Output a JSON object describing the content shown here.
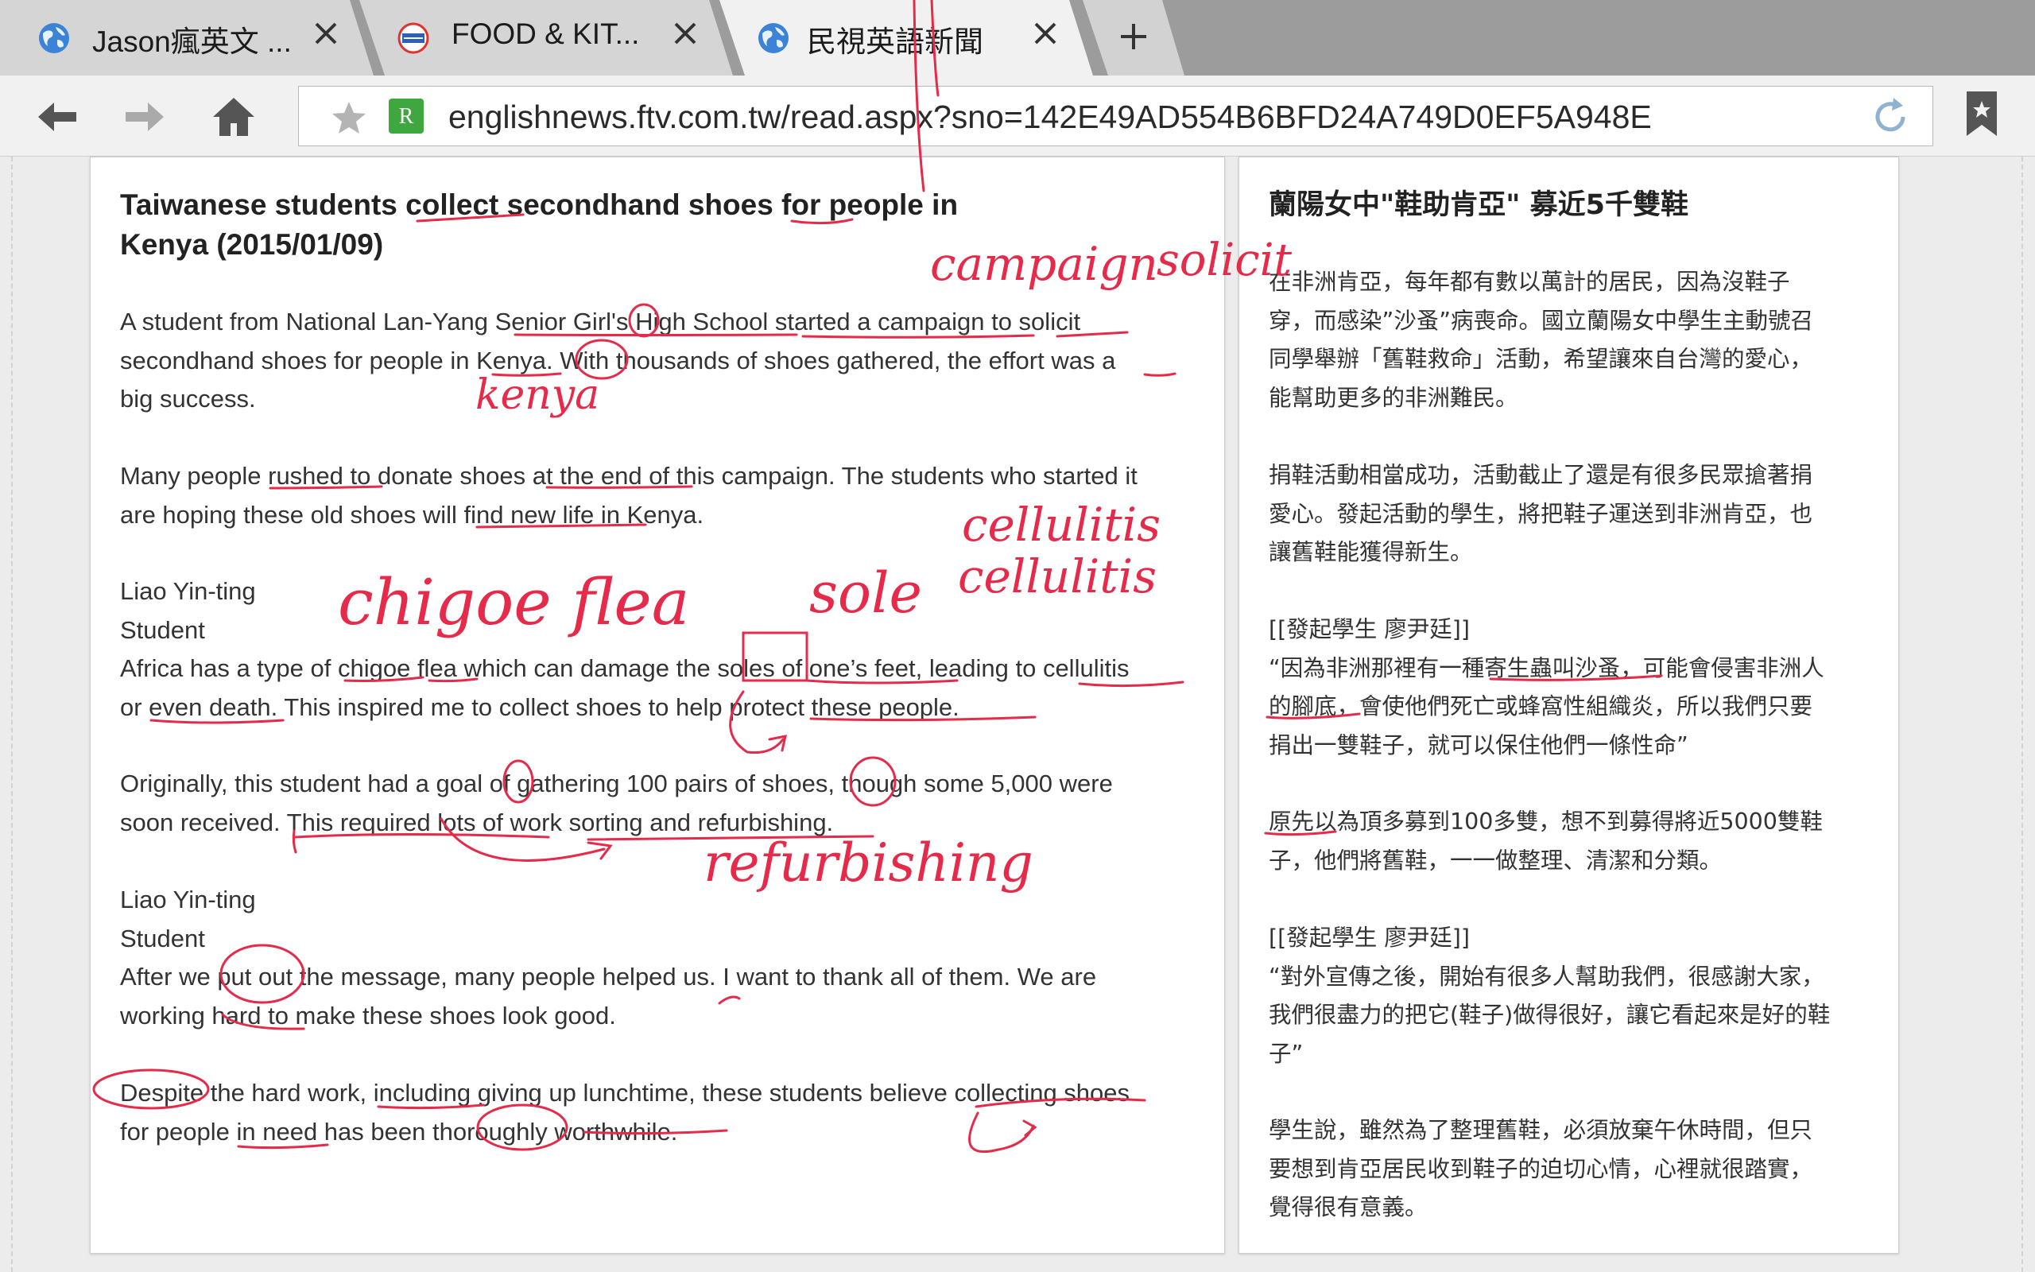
{
  "tabs": [
    {
      "title": "Jason瘋英文 ..."
    },
    {
      "title": "FOOD & KIT..."
    },
    {
      "title": "民視英語新聞"
    }
  ],
  "toolbar": {
    "url": "englishnews.ftv.com.tw/read.aspx?sno=142E49AD554B6BFD24A749D0EF5A948E"
  },
  "article_en": {
    "headline_lines": [
      "Taiwanese students collect secondhand shoes for people in",
      "Kenya (2015/01/09)"
    ],
    "p1": [
      "A student from National Lan-Yang Senior Girl's High School started a campaign to solicit",
      "secondhand shoes for people in Kenya. With thousands of shoes gathered, the effort was a",
      "big success."
    ],
    "p2": [
      "Many people rushed to donate shoes at the end of this campaign. The students who started it",
      "are hoping these old shoes will find new life in Kenya."
    ],
    "p3": [
      "Liao Yin-ting",
      "Student",
      "Africa has a type of chigoe flea which can damage the soles of one’s feet, leading to cellulitis",
      "or even death. This inspired me to collect shoes to help protect these people."
    ],
    "p4": [
      "Originally, this student had a goal of gathering 100 pairs of shoes, though some 5,000 were",
      "soon received. This required lots of work sorting and refurbishing."
    ],
    "p5": [
      "Liao Yin-ting",
      "Student",
      "After we put out the message, many people helped us. I want to thank all of them. We are",
      "working hard to make these shoes look good."
    ],
    "p6": [
      "Despite the hard work, including giving up lunchtime, these students believe collecting shoes",
      "for people in need has been thoroughly worthwhile."
    ]
  },
  "article_zh": {
    "headline": "蘭陽女中\"鞋助肯亞\" 募近5千雙鞋",
    "p1": [
      "在非洲肯亞，每年都有數以萬計的居民，因為沒鞋子",
      "穿，而感染”沙蚤”病喪命。國立蘭陽女中學生主動號召",
      "同學舉辦「舊鞋救命」活動，希望讓來自台灣的愛心，",
      "能幫助更多的非洲難民。"
    ],
    "p2": [
      "捐鞋活動相當成功，活動截止了還是有很多民眾搶著捐",
      "愛心。發起活動的學生，將把鞋子運送到非洲肯亞，也",
      "讓舊鞋能獲得新生。"
    ],
    "p3": [
      "[[發起學生 廖尹廷]]",
      "“因為非洲那裡有一種寄生蟲叫沙蚤，可能會侵害非洲人",
      "的腳底，會使他們死亡或蜂窩性組織炎，所以我們只要",
      "捐出一雙鞋子，就可以保住他們一條性命”"
    ],
    "p4": [
      "原先以為頂多募到100多雙，想不到募得將近5000雙鞋",
      "子，他們將舊鞋，一一做整理、清潔和分類。"
    ],
    "p5": [
      "[[發起學生 廖尹廷]]",
      "“對外宣傳之後，開始有很多人幫助我們，很感謝大家，",
      "我們很盡力的把它(鞋子)做得很好，讓它看起來是好的鞋",
      "子”"
    ],
    "p6": [
      "學生說，雖然為了整理舊鞋，必須放棄午休時間，但只",
      "要想到肯亞居民收到鞋子的迫切心情，心裡就很踏實，",
      "覺得很有意義。"
    ]
  },
  "annotations": {
    "campaign": "campaign",
    "solicit": "solicit",
    "kenya": "kenya",
    "cellulitis_1": "cellulitis",
    "cellulitis_2": "cellulitis",
    "chigoe_flea": "chigoe flea",
    "sole": "sole",
    "refurbishing": "refurbishing"
  },
  "colors": {
    "ink": "#e52a4a",
    "tabstrip": "#9c9c9c",
    "active_tab": "#f1f1f1",
    "globe": "#3a83d6"
  },
  "icons": {
    "back": "arrow-left-icon",
    "forward": "arrow-right-icon",
    "home": "home-icon",
    "star": "star-icon",
    "rss": "rss-icon",
    "reload": "reload-icon",
    "bookmark": "bookmark-icon",
    "close": "close-icon",
    "new_tab": "plus-icon"
  }
}
